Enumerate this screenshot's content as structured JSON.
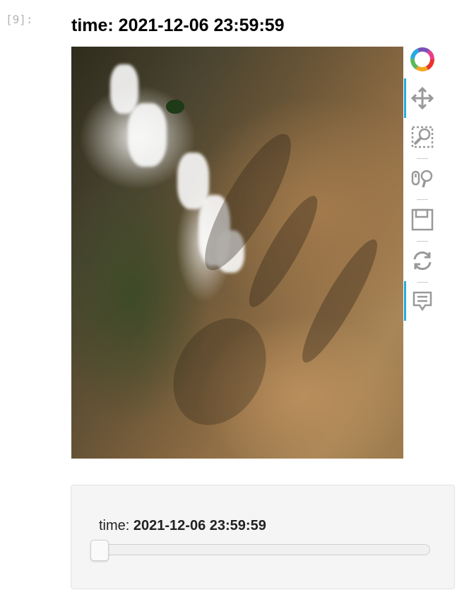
{
  "cell": {
    "prompt": "[9]:"
  },
  "plot": {
    "title": "time: 2021-12-06 23:59:59"
  },
  "toolbar": {
    "tools": [
      {
        "name": "logo",
        "icon": "bokeh-logo-icon"
      },
      {
        "name": "pan",
        "icon": "pan-icon",
        "active": true
      },
      {
        "name": "box-zoom",
        "icon": "box-zoom-icon"
      },
      {
        "name": "wheel-zoom",
        "icon": "wheel-zoom-icon"
      },
      {
        "name": "save",
        "icon": "save-icon"
      },
      {
        "name": "reset",
        "icon": "reset-icon"
      },
      {
        "name": "hover",
        "icon": "hover-icon",
        "active": true
      }
    ],
    "accent_color": "#26aae1"
  },
  "widget": {
    "label_prefix": "time:",
    "label_value": "2021-12-06 23:59:59",
    "slider_position": 0
  }
}
